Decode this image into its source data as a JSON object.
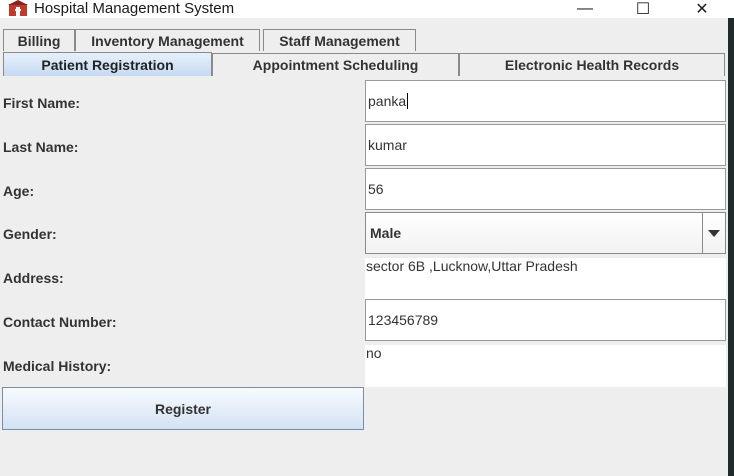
{
  "window": {
    "title": "Hospital Management System",
    "minimize": "—",
    "maximize": "☐",
    "close": "✕"
  },
  "tabs_row1": [
    {
      "label": "Billing"
    },
    {
      "label": "Inventory Management"
    },
    {
      "label": "Staff Management"
    }
  ],
  "tabs_row2": [
    {
      "label": "Patient Registration"
    },
    {
      "label": "Appointment Scheduling"
    },
    {
      "label": "Electronic Health Records"
    }
  ],
  "form": {
    "first_name_label": "First Name:",
    "first_name_value": "panka",
    "last_name_label": "Last Name:",
    "last_name_value": "kumar",
    "age_label": "Age:",
    "age_value": "56",
    "gender_label": "Gender:",
    "gender_value": "Male",
    "address_label": "Address:",
    "address_value": "sector 6B ,Lucknow,Uttar Pradesh",
    "contact_label": "Contact Number:",
    "contact_value": "123456789",
    "history_label": "Medical History:",
    "history_value": "no",
    "register_label": "Register"
  }
}
